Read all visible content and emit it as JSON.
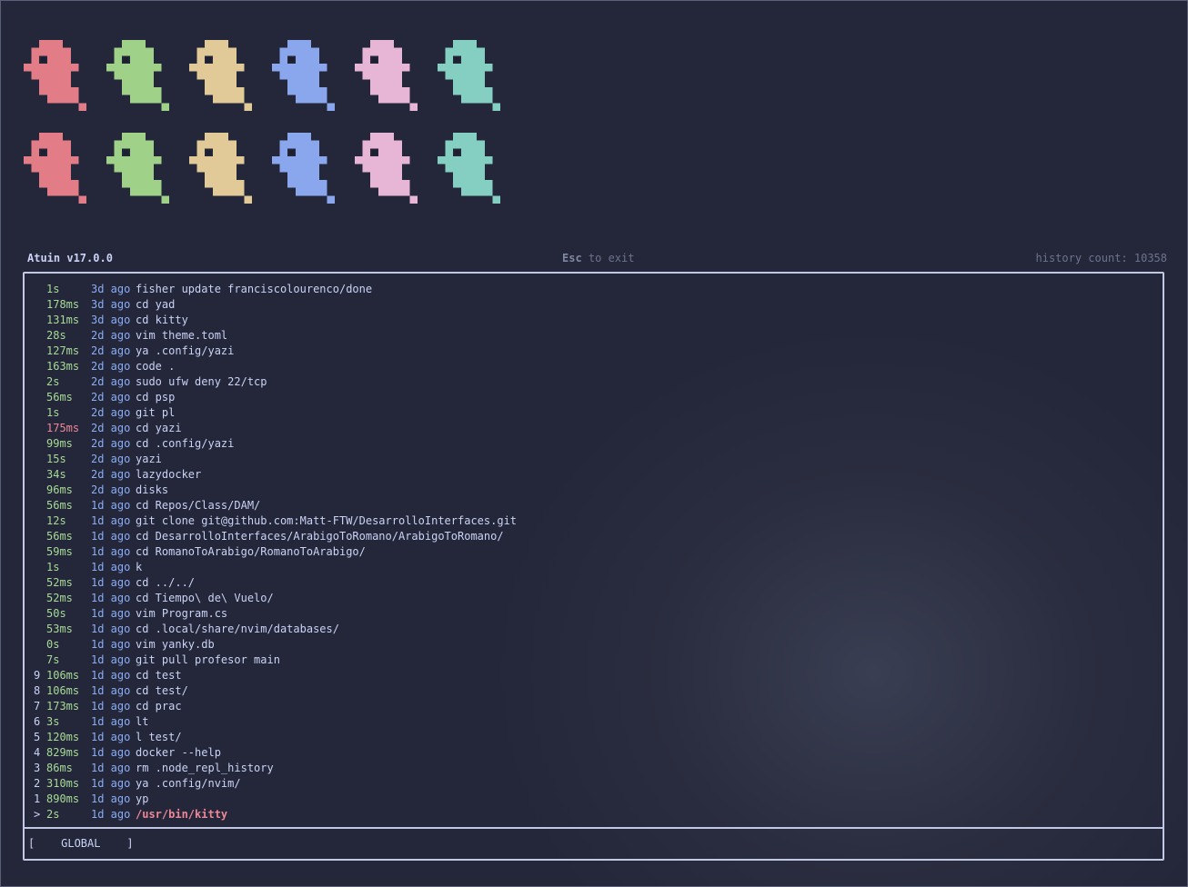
{
  "colors": {
    "ghosts": [
      "#e27d88",
      "#9fd189",
      "#e1c998",
      "#8aa7ee",
      "#e7b5d6",
      "#84cfc1"
    ],
    "duration_fast": "#a6da95",
    "duration_slow": "#ed8796",
    "time_ago": "#8aadf4",
    "selected_command": "#ed8796"
  },
  "header": {
    "title": "Atuin v17.0.0",
    "exit_key": "Esc",
    "exit_text": " to exit",
    "history_count": "history count: 10358"
  },
  "history": [
    {
      "index": "",
      "duration": "1s",
      "ago": "3d ago",
      "command": "fisher update franciscolourenco/done"
    },
    {
      "index": "",
      "duration": "178ms",
      "ago": "3d ago",
      "command": "cd yad"
    },
    {
      "index": "",
      "duration": "131ms",
      "ago": "3d ago",
      "command": "cd kitty"
    },
    {
      "index": "",
      "duration": "28s",
      "ago": "2d ago",
      "command": "vim theme.toml"
    },
    {
      "index": "",
      "duration": "127ms",
      "ago": "2d ago",
      "command": "ya .config/yazi"
    },
    {
      "index": "",
      "duration": "163ms",
      "ago": "2d ago",
      "command": "code ."
    },
    {
      "index": "",
      "duration": "2s",
      "ago": "2d ago",
      "command": "sudo ufw deny 22/tcp"
    },
    {
      "index": "",
      "duration": "56ms",
      "ago": "2d ago",
      "command": "cd psp"
    },
    {
      "index": "",
      "duration": "1s",
      "ago": "2d ago",
      "command": "git pl"
    },
    {
      "index": "",
      "duration": "175ms",
      "ago": "2d ago",
      "command": "cd yazi",
      "slow": true
    },
    {
      "index": "",
      "duration": "99ms",
      "ago": "2d ago",
      "command": "cd .config/yazi"
    },
    {
      "index": "",
      "duration": "15s",
      "ago": "2d ago",
      "command": "yazi"
    },
    {
      "index": "",
      "duration": "34s",
      "ago": "2d ago",
      "command": "lazydocker"
    },
    {
      "index": "",
      "duration": "96ms",
      "ago": "2d ago",
      "command": "disks"
    },
    {
      "index": "",
      "duration": "56ms",
      "ago": "1d ago",
      "command": "cd Repos/Class/DAM/"
    },
    {
      "index": "",
      "duration": "12s",
      "ago": "1d ago",
      "command": "git clone git@github.com:Matt-FTW/DesarrolloInterfaces.git"
    },
    {
      "index": "",
      "duration": "56ms",
      "ago": "1d ago",
      "command": "cd DesarrolloInterfaces/ArabigoToRomano/ArabigoToRomano/"
    },
    {
      "index": "",
      "duration": "59ms",
      "ago": "1d ago",
      "command": "cd RomanoToArabigo/RomanoToArabigo/"
    },
    {
      "index": "",
      "duration": "1s",
      "ago": "1d ago",
      "command": "k"
    },
    {
      "index": "",
      "duration": "52ms",
      "ago": "1d ago",
      "command": "cd ../../"
    },
    {
      "index": "",
      "duration": "52ms",
      "ago": "1d ago",
      "command": "cd Tiempo\\ de\\ Vuelo/"
    },
    {
      "index": "",
      "duration": "50s",
      "ago": "1d ago",
      "command": "vim Program.cs"
    },
    {
      "index": "",
      "duration": "53ms",
      "ago": "1d ago",
      "command": "cd .local/share/nvim/databases/"
    },
    {
      "index": "",
      "duration": "0s",
      "ago": "1d ago",
      "command": "vim yanky.db"
    },
    {
      "index": "",
      "duration": "7s",
      "ago": "1d ago",
      "command": "git pull profesor main"
    },
    {
      "index": "9",
      "duration": "106ms",
      "ago": "1d ago",
      "command": "cd test"
    },
    {
      "index": "8",
      "duration": "106ms",
      "ago": "1d ago",
      "command": "cd test/"
    },
    {
      "index": "7",
      "duration": "173ms",
      "ago": "1d ago",
      "command": "cd prac"
    },
    {
      "index": "6",
      "duration": "3s",
      "ago": "1d ago",
      "command": "lt"
    },
    {
      "index": "5",
      "duration": "120ms",
      "ago": "1d ago",
      "command": "l test/"
    },
    {
      "index": "4",
      "duration": "829ms",
      "ago": "1d ago",
      "command": "docker --help"
    },
    {
      "index": "3",
      "duration": "86ms",
      "ago": "1d ago",
      "command": "rm .node_repl_history"
    },
    {
      "index": "2",
      "duration": "310ms",
      "ago": "1d ago",
      "command": "ya .config/nvim/"
    },
    {
      "index": "1",
      "duration": "890ms",
      "ago": "1d ago",
      "command": "yp"
    },
    {
      "index": ">",
      "duration": "2s",
      "ago": "1d ago",
      "command": "/usr/bin/kitty",
      "selected": true
    }
  ],
  "footer": {
    "filter_mode": "[    GLOBAL    ]"
  }
}
